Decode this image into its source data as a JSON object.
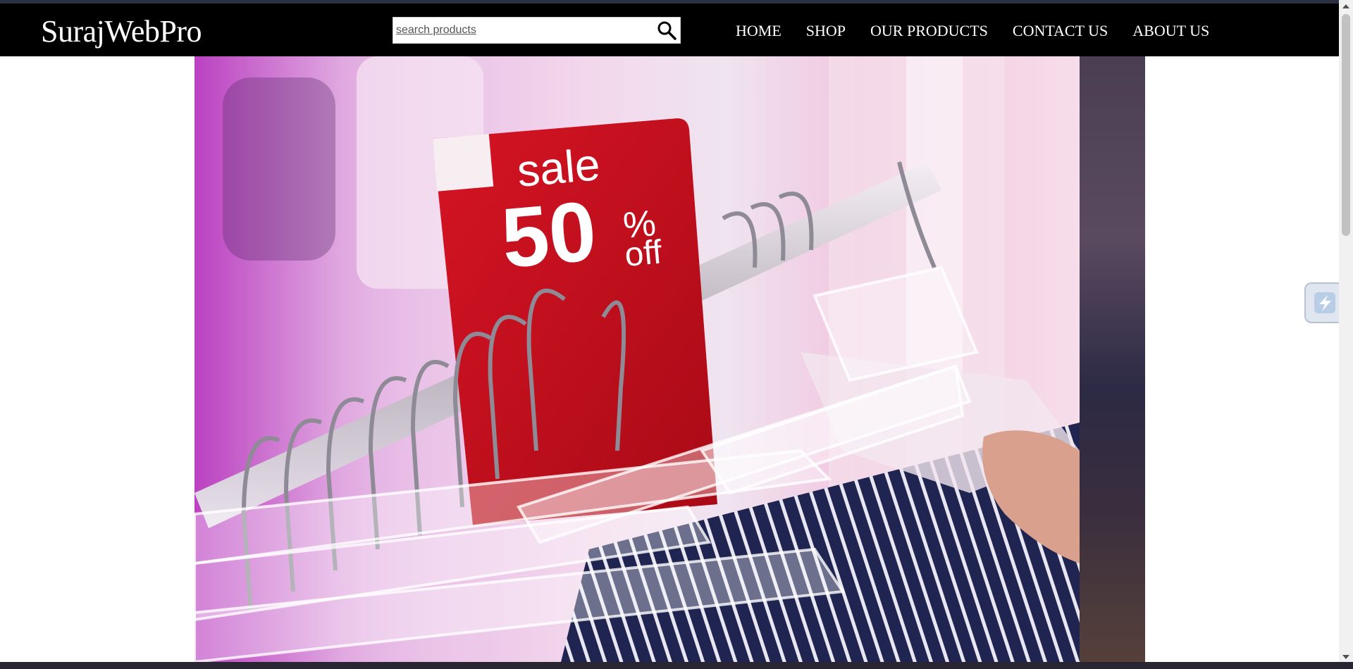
{
  "brand": {
    "name": "SurajWebPro"
  },
  "search": {
    "placeholder": "search products",
    "icon": "search-icon"
  },
  "nav": {
    "links": [
      {
        "label": "HOME"
      },
      {
        "label": "SHOP"
      },
      {
        "label": "OUR PRODUCTS"
      },
      {
        "label": "CONTACT US"
      },
      {
        "label": "ABOUT US"
      }
    ]
  },
  "hero": {
    "sale_sign": {
      "word": "sale",
      "number": "50",
      "percent": "%",
      "off": "off"
    },
    "colors": {
      "sign_red": "#c8101e",
      "navbar": "#000000"
    }
  }
}
